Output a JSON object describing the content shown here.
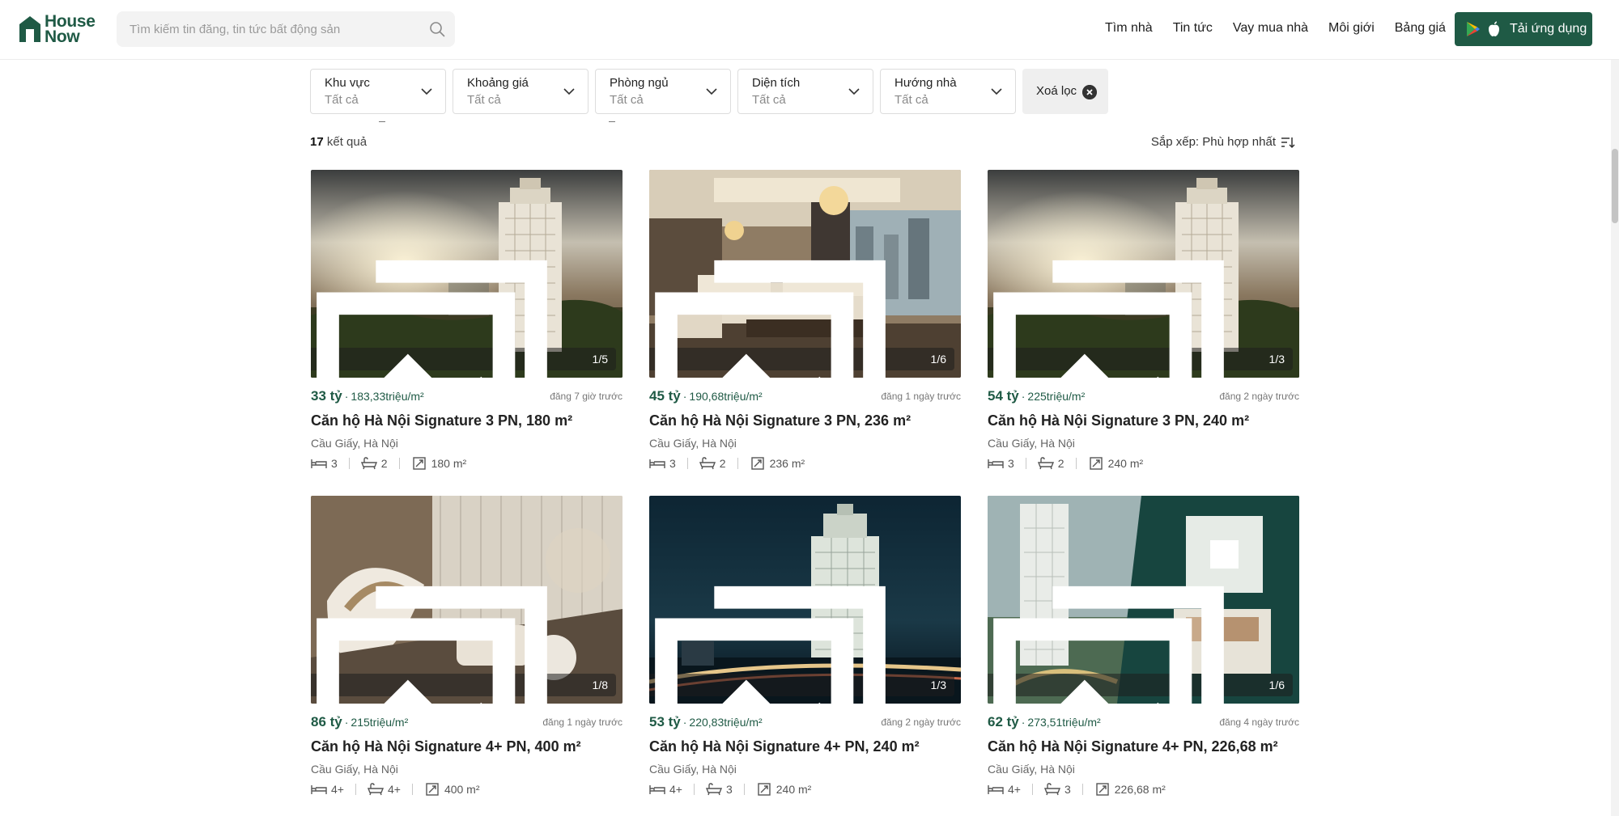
{
  "header": {
    "logo_line1": "House",
    "logo_line2": "Now",
    "search_placeholder": "Tìm kiếm tin đăng, tin tức bất động sản",
    "nav": [
      "Tìm nhà",
      "Tin tức",
      "Vay mua nhà",
      "Môi giới",
      "Bảng giá"
    ],
    "app_button": "Tải ứng dụng"
  },
  "filters": [
    {
      "label": "Khu vực",
      "value": "Tất cả"
    },
    {
      "label": "Khoảng giá",
      "value": "Tất cả"
    },
    {
      "label": "Phòng ngủ",
      "value": "Tất cả"
    },
    {
      "label": "Diện tích",
      "value": "Tất cả"
    },
    {
      "label": "Hướng nhà",
      "value": "Tất cả"
    }
  ],
  "clear_filter": "Xoá lọc",
  "results": {
    "count": "17",
    "label": "kết quả"
  },
  "sort": {
    "label": "Sắp xếp: Phù hợp nhất"
  },
  "listings": [
    {
      "price": "33 tỷ",
      "ppm": "183,33triệu/m²",
      "posted": "đăng 7 giờ trước",
      "title": "Căn hộ Hà Nội Signature 3 PN, 180 m²",
      "location": "Cầu Giấy, Hà Nội",
      "beds": "3",
      "baths": "2",
      "area": "180 m²",
      "photos": "1/5",
      "image": "tower-sunset"
    },
    {
      "price": "45 tỷ",
      "ppm": "190,68triệu/m²",
      "posted": "đăng 1 ngày trước",
      "title": "Căn hộ Hà Nội Signature 3 PN, 236 m²",
      "location": "Cầu Giấy, Hà Nội",
      "beds": "3",
      "baths": "2",
      "area": "236 m²",
      "photos": "1/6",
      "image": "living-room"
    },
    {
      "price": "54 tỷ",
      "ppm": "225triệu/m²",
      "posted": "đăng 2 ngày trước",
      "title": "Căn hộ Hà Nội Signature 3 PN, 240 m²",
      "location": "Cầu Giấy, Hà Nội",
      "beds": "3",
      "baths": "2",
      "area": "240 m²",
      "photos": "1/3",
      "image": "tower-sunset"
    },
    {
      "price": "86 tỷ",
      "ppm": "215triệu/m²",
      "posted": "đăng 1 ngày trước",
      "title": "Căn hộ Hà Nội Signature 4+ PN, 400 m²",
      "location": "Cầu Giấy, Hà Nội",
      "beds": "4+",
      "baths": "4+",
      "area": "400 m²",
      "photos": "1/8",
      "image": "spiral-stair"
    },
    {
      "price": "53 tỷ",
      "ppm": "220,83triệu/m²",
      "posted": "đăng 2 ngày trước",
      "title": "Căn hộ Hà Nội Signature 4+ PN, 240 m²",
      "location": "Cầu Giấy, Hà Nội",
      "beds": "4+",
      "baths": "3",
      "area": "240 m²",
      "photos": "1/3",
      "image": "tower-night"
    },
    {
      "price": "62 tỷ",
      "ppm": "273,51triệu/m²",
      "posted": "đăng 4 ngày trước",
      "title": "Căn hộ Hà Nội Signature 4+ PN, 226,68 m²",
      "location": "Cầu Giấy, Hà Nội",
      "beds": "4+",
      "baths": "3",
      "area": "226,68 m²",
      "photos": "1/6",
      "image": "brochure-green"
    }
  ]
}
